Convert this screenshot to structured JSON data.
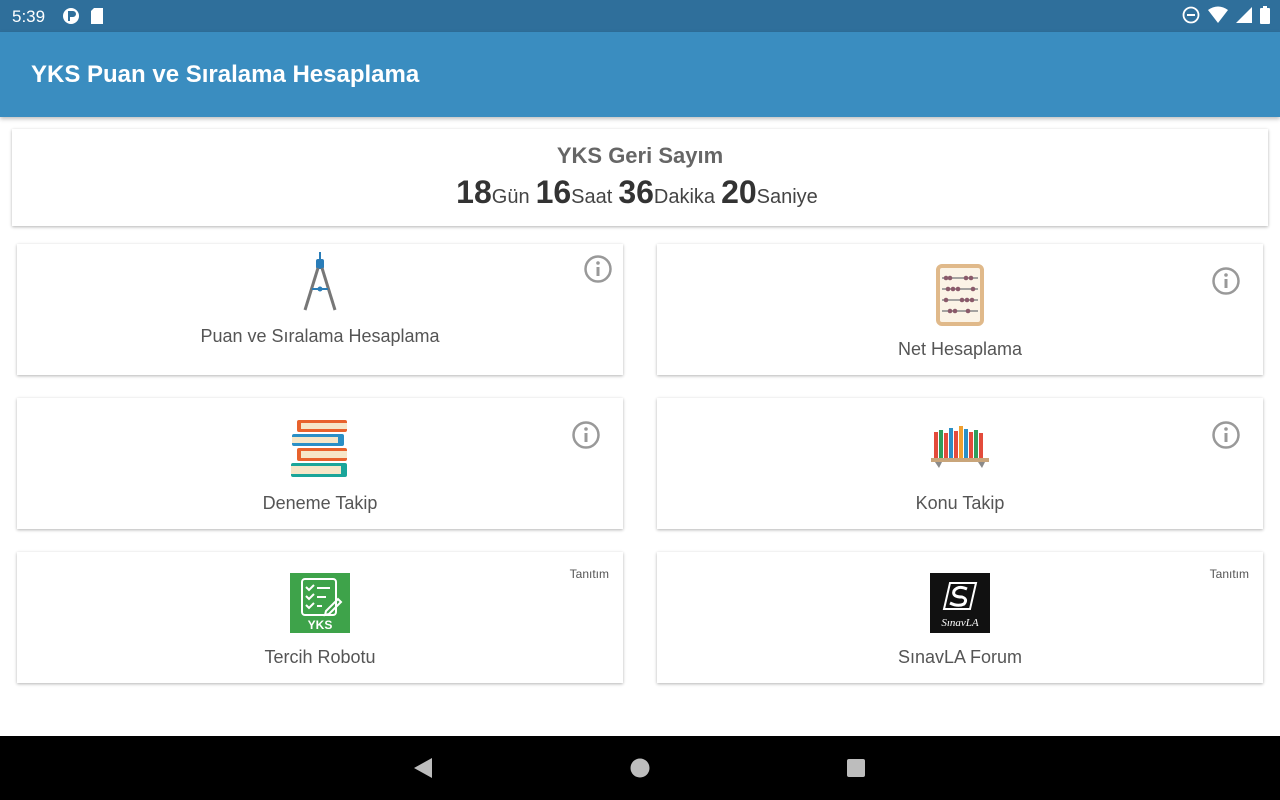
{
  "status_bar": {
    "time": "5:39",
    "left_icons": [
      "pinwheel-icon",
      "sd-card-icon"
    ],
    "right_icons": [
      "do-not-disturb-icon",
      "wifi-icon",
      "signal-icon",
      "battery-icon"
    ]
  },
  "app_bar": {
    "title": "YKS Puan ve Sıralama Hesaplama",
    "color": "#3a8dc0"
  },
  "countdown": {
    "title": "YKS Geri Sayım",
    "days": "18",
    "days_unit": "Gün",
    "hours": "16",
    "hours_unit": "Saat",
    "minutes": "36",
    "minutes_unit": "Dakika",
    "seconds": "20",
    "seconds_unit": "Saniye"
  },
  "cards": {
    "puan": {
      "label": "Puan ve Sıralama Hesaplama",
      "icon": "compass-icon"
    },
    "net": {
      "label": "Net Hesaplama",
      "icon": "abacus-icon"
    },
    "deneme": {
      "label": "Deneme Takip",
      "icon": "books-stack-icon"
    },
    "konu": {
      "label": "Konu Takip",
      "icon": "bookshelf-icon"
    },
    "tercih": {
      "label": "Tercih Robotu",
      "icon": "yks-checklist-icon",
      "tag": "Tanıtım",
      "logo_text": "YKS"
    },
    "forum": {
      "label": "SınavLA Forum",
      "icon": "sinavla-logo-icon",
      "tag": "Tanıtım",
      "logo_text": "SınavLA"
    }
  },
  "nav_bar": {
    "icons": [
      "back-icon",
      "home-icon",
      "recents-icon"
    ]
  }
}
